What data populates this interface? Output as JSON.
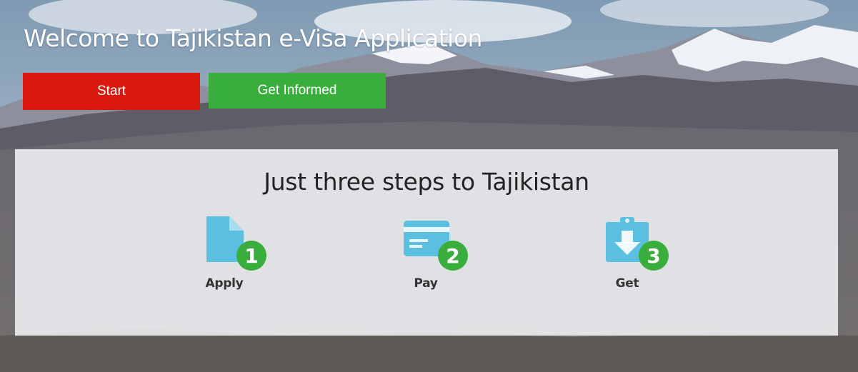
{
  "header": {
    "title": "Welcome to Tajikistan e-Visa Application"
  },
  "buttons": {
    "start_label": "Start",
    "info_label": "Get Informed"
  },
  "steps_panel": {
    "title": "Just three steps to Tajikistan",
    "steps": [
      {
        "number": "1",
        "label": "Apply",
        "icon": "document-icon"
      },
      {
        "number": "2",
        "label": "Pay",
        "icon": "credit-card-icon"
      },
      {
        "number": "3",
        "label": "Get",
        "icon": "download-clipboard-icon"
      }
    ]
  },
  "colors": {
    "start": "#d9190d",
    "info": "#39ae3c",
    "icon": "#5bbfdf",
    "badge": "#39ae3c"
  }
}
